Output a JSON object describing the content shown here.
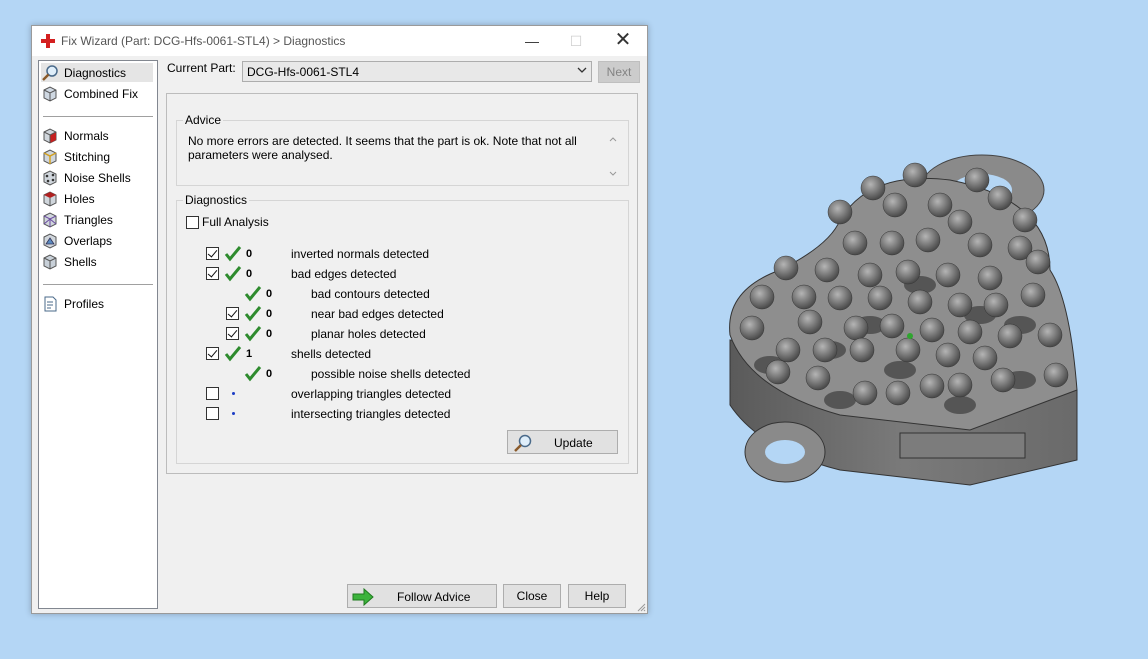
{
  "window": {
    "title": "Fix Wizard (Part: DCG-Hfs-0061-STL4) > Diagnostics",
    "minimize": "—",
    "maximize": "☐",
    "close": "✕"
  },
  "nav": {
    "items": [
      {
        "label": "Diagnostics",
        "icon": "magnifier-icon"
      },
      {
        "label": "Combined Fix",
        "icon": "cube-icon"
      },
      {
        "label": "Normals",
        "icon": "normals-cube-icon"
      },
      {
        "label": "Stitching",
        "icon": "stitching-cube-icon"
      },
      {
        "label": "Noise Shells",
        "icon": "noise-shells-icon"
      },
      {
        "label": "Holes",
        "icon": "holes-cube-icon"
      },
      {
        "label": "Triangles",
        "icon": "triangles-icon"
      },
      {
        "label": "Overlaps",
        "icon": "overlaps-icon"
      },
      {
        "label": "Shells",
        "icon": "shells-icon"
      },
      {
        "label": "Profiles",
        "icon": "profiles-document-icon"
      }
    ]
  },
  "current_part": {
    "label": "Current Part:",
    "value": "DCG-Hfs-0061-STL4",
    "next_label": "Next"
  },
  "advice": {
    "label": "Advice",
    "text": "No more errors are detected. It seems that the part is ok. Note that not all parameters were analysed."
  },
  "diagnostics": {
    "label": "Diagnostics",
    "full_analysis_label": "Full Analysis",
    "full_analysis_checked": false,
    "rows": [
      {
        "checked": true,
        "status": "ok",
        "count": "0",
        "label": "inverted normals detected",
        "indent": 0,
        "has_checkbox": true
      },
      {
        "checked": true,
        "status": "ok",
        "count": "0",
        "label": "bad edges detected",
        "indent": 0,
        "has_checkbox": true
      },
      {
        "checked": false,
        "status": "ok",
        "count": "0",
        "label": "bad contours detected",
        "indent": 1,
        "has_checkbox": false
      },
      {
        "checked": true,
        "status": "ok",
        "count": "0",
        "label": "near bad edges detected",
        "indent": 1,
        "has_checkbox": true
      },
      {
        "checked": true,
        "status": "ok",
        "count": "0",
        "label": "planar holes detected",
        "indent": 1,
        "has_checkbox": true
      },
      {
        "checked": true,
        "status": "ok",
        "count": "1",
        "label": "shells detected",
        "indent": 0,
        "has_checkbox": true
      },
      {
        "checked": false,
        "status": "ok",
        "count": "0",
        "label": "possible noise shells detected",
        "indent": 1,
        "has_checkbox": false
      },
      {
        "checked": false,
        "status": "pending",
        "count": "",
        "label": "overlapping triangles detected",
        "indent": 0,
        "has_checkbox": true
      },
      {
        "checked": false,
        "status": "pending",
        "count": "",
        "label": "intersecting triangles detected",
        "indent": 0,
        "has_checkbox": true
      }
    ],
    "update_label": "Update"
  },
  "footer": {
    "follow_advice_label": "Follow Advice",
    "close_label": "Close",
    "help_label": "Help"
  },
  "colors": {
    "desktop": "#b4d6f5",
    "checkmark": "#2e8b2e",
    "dot": "#1b3cc4",
    "arrow": "#3cb33c"
  }
}
